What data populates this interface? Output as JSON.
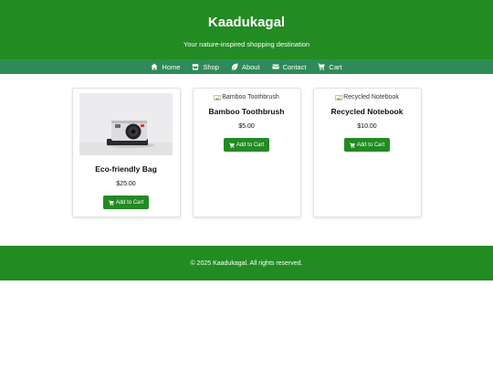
{
  "header": {
    "title": "Kaadukagal",
    "tagline": "Your nature-inspired shopping destination"
  },
  "nav": {
    "items": [
      {
        "label": "Home",
        "icon": "home-icon"
      },
      {
        "label": "Shop",
        "icon": "store-icon"
      },
      {
        "label": "About",
        "icon": "leaf-icon"
      },
      {
        "label": "Contact",
        "icon": "envelope-icon"
      },
      {
        "label": "Cart",
        "icon": "cart-icon"
      }
    ]
  },
  "products": [
    {
      "name": "Eco-friendly Bag",
      "price": "$25.00",
      "image_alt": "",
      "button_label": "Add to Cart"
    },
    {
      "name": "Bamboo Toothbrush",
      "price": "$5.00",
      "image_alt": "Bamboo Toothbrush",
      "button_label": "Add to Cart"
    },
    {
      "name": "Recycled Notebook",
      "price": "$10.00",
      "image_alt": "Recycled Notebook",
      "button_label": "Add to Cart"
    }
  ],
  "footer": {
    "text": "© 2025 Kaadukagal. All rights reserved."
  },
  "colors": {
    "header_bg": "#228b22",
    "nav_bg": "#2e8b57",
    "button_bg": "#228b22"
  }
}
